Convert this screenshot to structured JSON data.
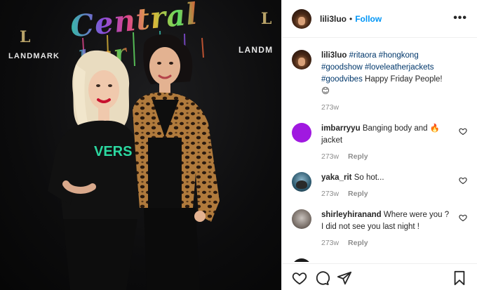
{
  "post": {
    "username": "lili3luo",
    "follow_label": "Follow",
    "dot": "•",
    "more_icon": "more-horizontal-icon"
  },
  "photo": {
    "neon_line1": "Central",
    "neon_line2": "bar",
    "brand_left": "LANDMARK",
    "brand_right": "LANDM",
    "brand_mark": "L",
    "shirt_text": "VERS"
  },
  "caption": {
    "username": "lili3luo",
    "tags": "#ritaora #hongkong #goodshow #loveleatherjackets #goodvibes",
    "text": "Happy Friday People! 😊",
    "time": "273w"
  },
  "comments": [
    {
      "username": "imbarryyu",
      "text": "Banging body and 🔥 jacket",
      "time": "273w",
      "reply_label": "Reply"
    },
    {
      "username": "yaka_rit",
      "text": "So hot...",
      "time": "273w",
      "reply_label": "Reply"
    },
    {
      "username": "shirleyhiranand",
      "text": "Where were you ? I did not see you last night !",
      "time": "273w",
      "reply_label": "Reply"
    }
  ],
  "icons": {
    "like": "heart-icon",
    "comment": "comment-icon",
    "share": "share-icon",
    "save": "bookmark-icon"
  },
  "colors": {
    "accent": "#0095f6",
    "hashtag": "#00376b",
    "muted": "#8e8e8e"
  }
}
